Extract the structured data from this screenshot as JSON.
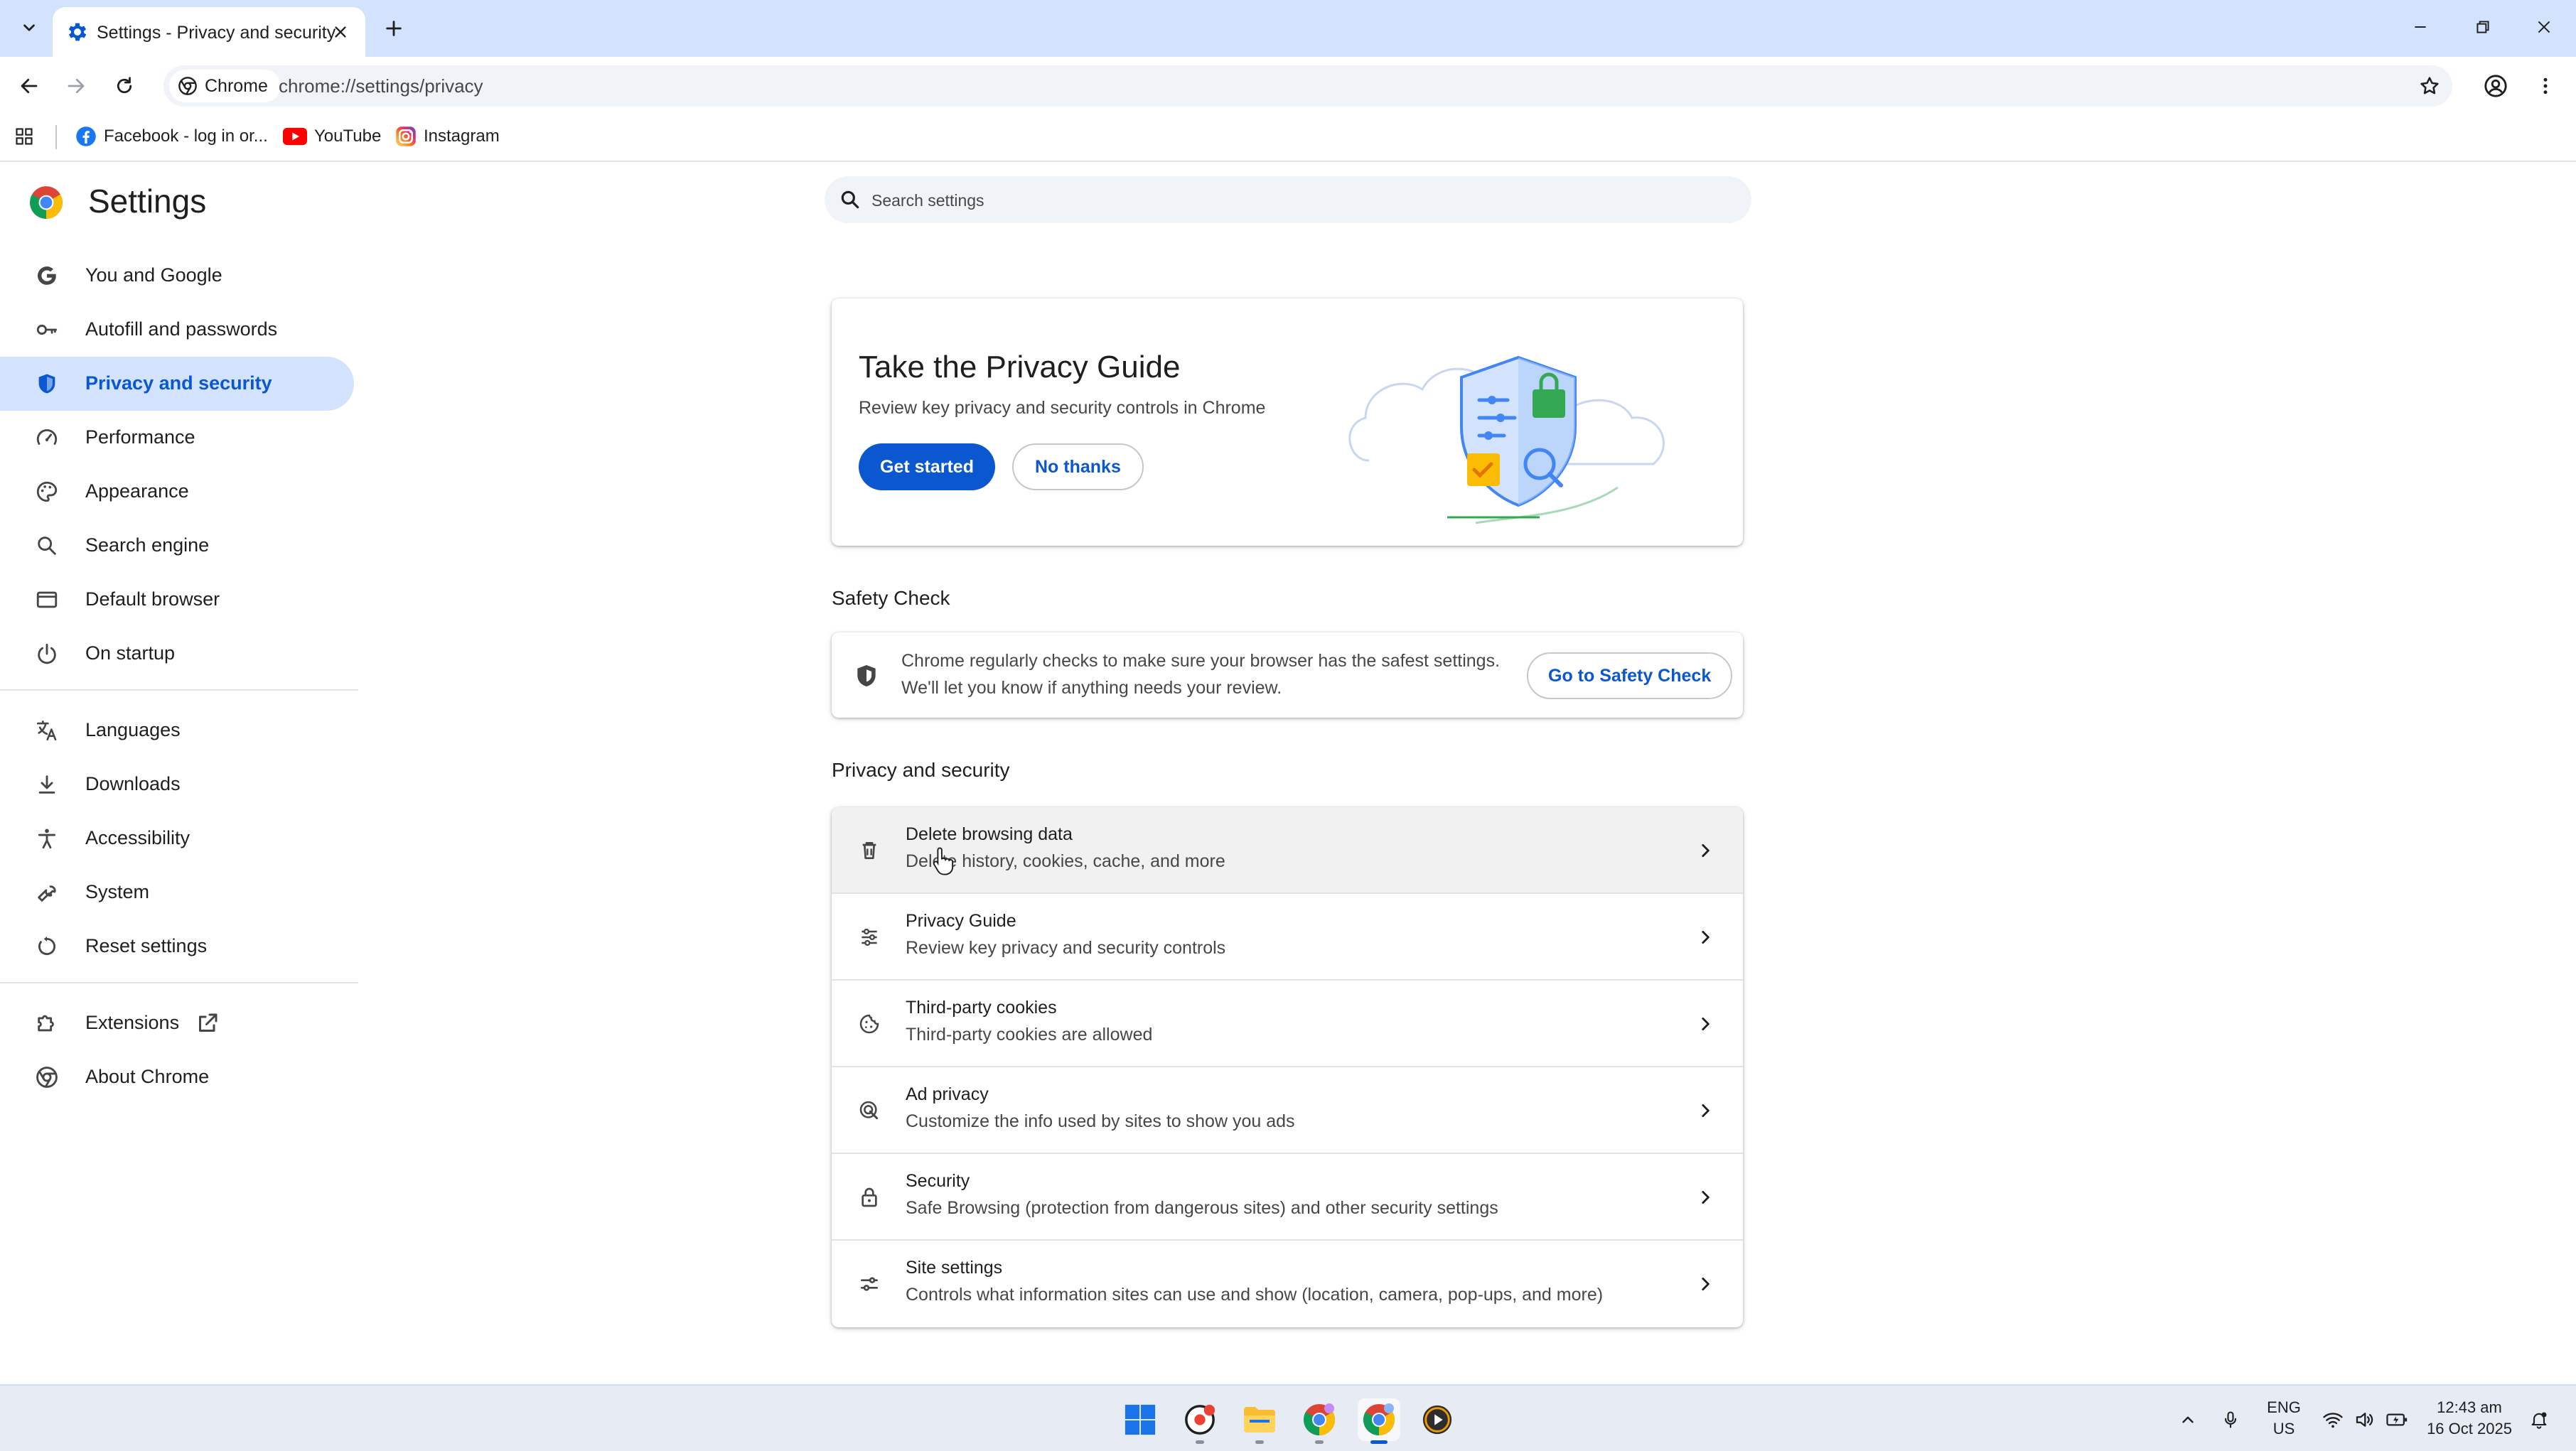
{
  "browser": {
    "tab": {
      "title": "Settings - Privacy and security"
    },
    "omnibox": {
      "chip_label": "Chrome",
      "url": "chrome://settings/privacy"
    },
    "bookmarks": [
      {
        "label": "Facebook - log in or...",
        "icon": "facebook-icon"
      },
      {
        "label": "YouTube",
        "icon": "youtube-icon"
      },
      {
        "label": "Instagram",
        "icon": "instagram-icon"
      }
    ]
  },
  "settings": {
    "title": "Settings",
    "search": {
      "placeholder": "Search settings"
    },
    "nav": [
      {
        "label": "You and Google",
        "icon": "google-g-icon"
      },
      {
        "label": "Autofill and passwords",
        "icon": "key-icon"
      },
      {
        "label": "Privacy and security",
        "icon": "shield-icon",
        "selected": true
      },
      {
        "label": "Performance",
        "icon": "speedometer-icon"
      },
      {
        "label": "Appearance",
        "icon": "palette-icon"
      },
      {
        "label": "Search engine",
        "icon": "search-icon"
      },
      {
        "label": "Default browser",
        "icon": "browser-window-icon"
      },
      {
        "label": "On startup",
        "icon": "power-icon"
      },
      {
        "label": "Languages",
        "icon": "translate-icon"
      },
      {
        "label": "Downloads",
        "icon": "download-icon"
      },
      {
        "label": "Accessibility",
        "icon": "accessibility-icon"
      },
      {
        "label": "System",
        "icon": "wrench-icon"
      },
      {
        "label": "Reset settings",
        "icon": "reset-icon"
      },
      {
        "label": "Extensions",
        "icon": "puzzle-icon"
      },
      {
        "label": "About Chrome",
        "icon": "chrome-icon"
      }
    ],
    "privacy_guide_card": {
      "title": "Take the Privacy Guide",
      "description": "Review key privacy and security controls in Chrome",
      "primary_button": "Get started",
      "secondary_button": "No thanks"
    },
    "safety_check": {
      "section_title": "Safety Check",
      "line1": "Chrome regularly checks to make sure your browser has the safest settings.",
      "line2": "We'll let you know if anything needs your review.",
      "button": "Go to Safety Check"
    },
    "privacy_section": {
      "title": "Privacy and security",
      "rows": [
        {
          "title": "Delete browsing data",
          "subtitle": "Delete history, cookies, cache, and more",
          "icon": "trash-icon"
        },
        {
          "title": "Privacy Guide",
          "subtitle": "Review key privacy and security controls",
          "icon": "privacy-guide-icon"
        },
        {
          "title": "Third-party cookies",
          "subtitle": "Third-party cookies are allowed",
          "icon": "cookie-icon"
        },
        {
          "title": "Ad privacy",
          "subtitle": "Customize the info used by sites to show you ads",
          "icon": "ad-privacy-icon"
        },
        {
          "title": "Security",
          "subtitle": "Safe Browsing (protection from dangerous sites) and other security settings",
          "icon": "lock-icon"
        },
        {
          "title": "Site settings",
          "subtitle": "Controls what information sites can use and show (location, camera, pop-ups, and more)",
          "icon": "tune-icon"
        }
      ]
    }
  },
  "taskbar": {
    "language": {
      "line1": "ENG",
      "line2": "US"
    },
    "clock": {
      "time": "12:43 am",
      "date": "16 Oct 2025"
    }
  },
  "colors": {
    "accent": "#0b57d0",
    "selected_bg": "#d3e3fd",
    "title_bar": "#d3e3fd"
  }
}
